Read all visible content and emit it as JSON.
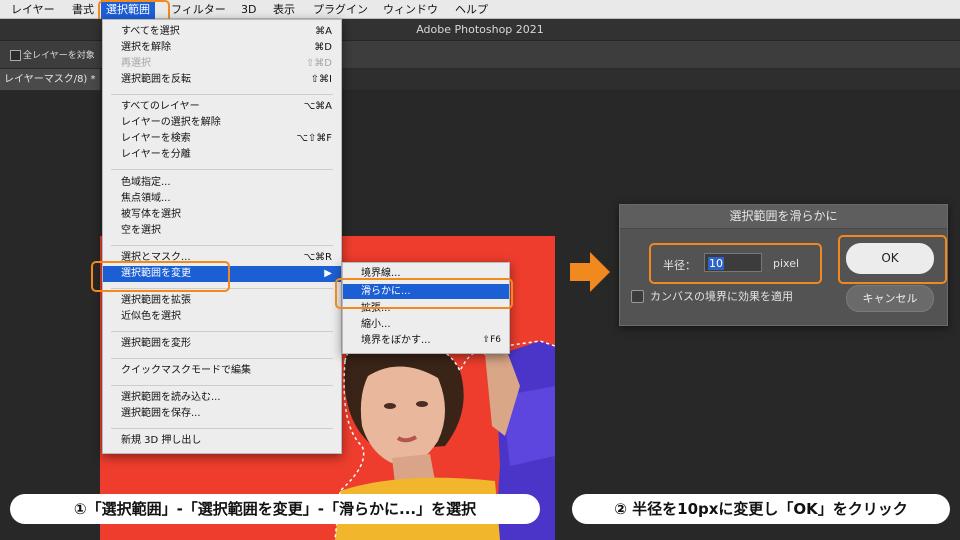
{
  "menubar": {
    "items": [
      "レイヤー",
      "書式",
      "選択範囲",
      "フィルター",
      "3D",
      "表示",
      "プラグイン",
      "ウィンドウ",
      "ヘルプ"
    ]
  },
  "titlebar": {
    "title": "Adobe Photoshop 2021"
  },
  "optionsbar": {
    "sample_all_layers": "全レイヤーを対象"
  },
  "document": {
    "tab_label": "レイヤーマスク/8) *"
  },
  "select_menu": {
    "items": [
      {
        "label": "すべてを選択",
        "shortcut": "⌘A"
      },
      {
        "label": "選択を解除",
        "shortcut": "⌘D"
      },
      {
        "label": "再選択",
        "shortcut": "⇧⌘D"
      },
      {
        "label": "選択範囲を反転",
        "shortcut": "⇧⌘I"
      },
      {
        "label": "すべてのレイヤー",
        "shortcut": "⌥⌘A"
      },
      {
        "label": "レイヤーの選択を解除",
        "shortcut": ""
      },
      {
        "label": "レイヤーを検索",
        "shortcut": "⌥⇧⌘F"
      },
      {
        "label": "レイヤーを分離",
        "shortcut": ""
      },
      {
        "label": "色域指定...",
        "shortcut": ""
      },
      {
        "label": "焦点領域...",
        "shortcut": ""
      },
      {
        "label": "被写体を選択",
        "shortcut": ""
      },
      {
        "label": "空を選択",
        "shortcut": ""
      },
      {
        "label": "選択とマスク...",
        "shortcut": "⌥⌘R"
      },
      {
        "label": "選択範囲を変更",
        "shortcut": "▶"
      },
      {
        "label": "選択範囲を拡張",
        "shortcut": ""
      },
      {
        "label": "近似色を選択",
        "shortcut": ""
      },
      {
        "label": "選択範囲を変形",
        "shortcut": ""
      },
      {
        "label": "クイックマスクモードで編集",
        "shortcut": ""
      },
      {
        "label": "選択範囲を読み込む...",
        "shortcut": ""
      },
      {
        "label": "選択範囲を保存...",
        "shortcut": ""
      },
      {
        "label": "新規 3D 押し出し",
        "shortcut": ""
      }
    ]
  },
  "modify_submenu": {
    "items": [
      {
        "label": "境界線...",
        "shortcut": ""
      },
      {
        "label": "滑らかに...",
        "shortcut": ""
      },
      {
        "label": "拡張...",
        "shortcut": ""
      },
      {
        "label": "縮小...",
        "shortcut": ""
      },
      {
        "label": "境界をぼかす...",
        "shortcut": "⇧F6"
      }
    ]
  },
  "smooth_dialog": {
    "title": "選択範囲を滑らかに",
    "radius_label": "半径：",
    "radius_value": "10",
    "unit": "pixel",
    "ok": "OK",
    "cancel": "キャンセル",
    "clamp_label": "カンバスの境界に効果を適用"
  },
  "captions": {
    "step1": "①「選択範囲」-「選択範囲を変更」-「滑らかに...」を選択",
    "step2": "② 半径を10pxに変更し「OK」をクリック"
  },
  "colors": {
    "highlight": "#f08a1e",
    "menu_selected": "#1c5fd4",
    "canvas": "#ee3d2d"
  }
}
